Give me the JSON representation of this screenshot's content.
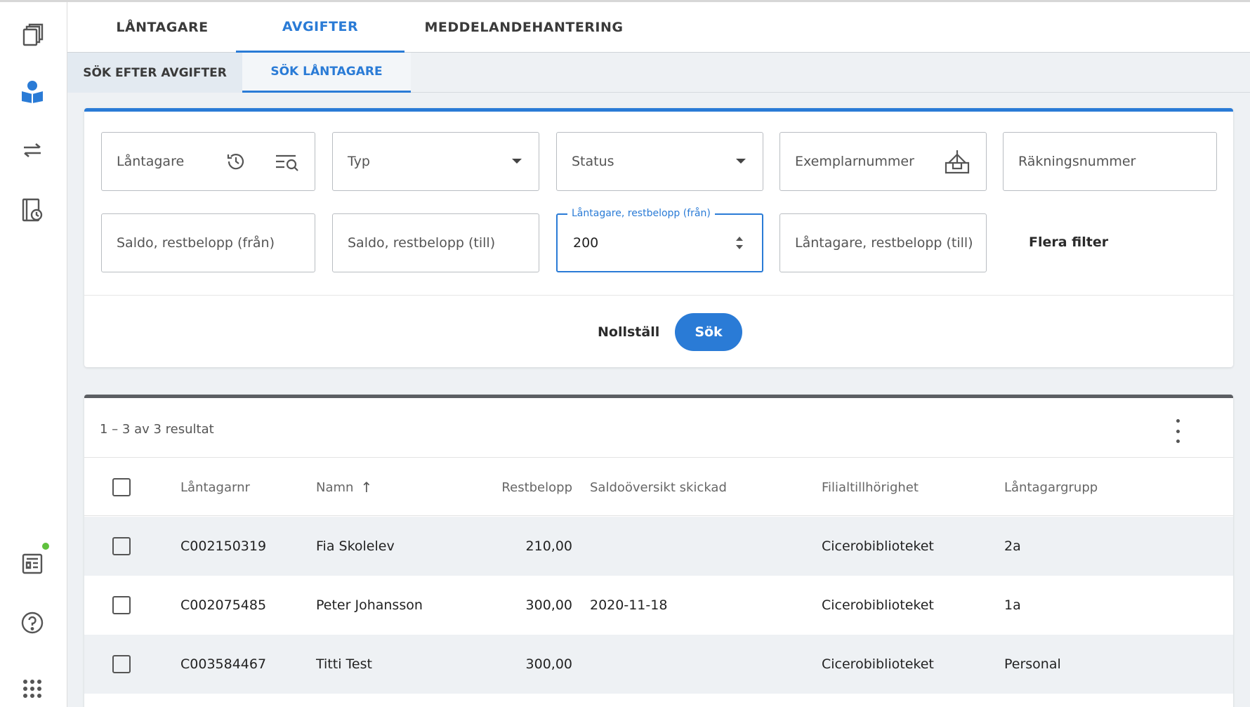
{
  "tabs": [
    {
      "label": "LÅNTAGARE",
      "active": false
    },
    {
      "label": "AVGIFTER",
      "active": true
    },
    {
      "label": "MEDDELANDEHANTERING",
      "active": false
    }
  ],
  "subtabs": [
    {
      "label": "SÖK EFTER AVGIFTER",
      "active": false
    },
    {
      "label": "SÖK LÅNTAGARE",
      "active": true
    }
  ],
  "filters": {
    "borrower": "Låntagare",
    "type": "Typ",
    "status": "Status",
    "copy_number": "Exemplarnummer",
    "invoice_number": "Räkningsnummer",
    "balance_from": "Saldo, restbelopp (från)",
    "balance_to": "Saldo, restbelopp (till)",
    "borrower_amount_from_label": "Låntagare, restbelopp (från)",
    "borrower_amount_from_value": "200",
    "borrower_amount_to": "Låntagare, restbelopp (till)",
    "more_filters": "Flera filter"
  },
  "actions": {
    "reset": "Nollställ",
    "search": "Sök"
  },
  "results": {
    "count_text": "1 – 3 av 3 resultat",
    "columns": [
      "Låntagarnr",
      "Namn",
      "Restbelopp",
      "Saldoöversikt skickad",
      "Filialtillhörighet",
      "Låntagargrupp"
    ],
    "sort_indicator": "↑",
    "rows": [
      {
        "id": "C002150319",
        "name": "Fia Skolelev",
        "amount": "210,00",
        "sent": "",
        "branch": "Cicerobiblioteket",
        "group": "2a"
      },
      {
        "id": "C002075485",
        "name": "Peter Johansson",
        "amount": "300,00",
        "sent": "2020-11-18",
        "branch": "Cicerobiblioteket",
        "group": "1a"
      },
      {
        "id": "C003584467",
        "name": "Titti Test",
        "amount": "300,00",
        "sent": "",
        "branch": "Cicerobiblioteket",
        "group": "Personal"
      }
    ]
  },
  "icons": {
    "rail": [
      "books-icon",
      "reader-icon",
      "swap-arrows-icon",
      "history-book-icon",
      "news-icon",
      "help-icon",
      "apps-grid-icon"
    ]
  },
  "colors": {
    "accent": "#2a7bd6",
    "notification": "#5fc13d"
  }
}
